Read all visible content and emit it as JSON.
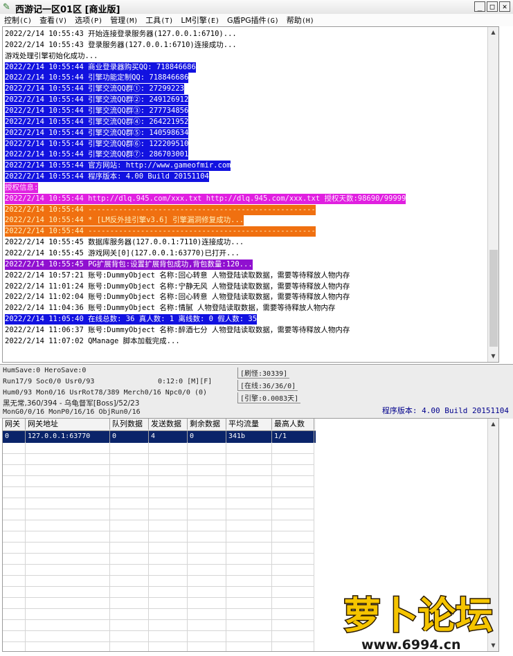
{
  "window": {
    "title": "西游记一区01区 [商业版]",
    "buttons": [
      "_",
      "□",
      "✕"
    ]
  },
  "menu": [
    {
      "label": "控制",
      "acc": "(C)"
    },
    {
      "label": "查看",
      "acc": "(V)"
    },
    {
      "label": "选项",
      "acc": "(P)"
    },
    {
      "label": "管理",
      "acc": "(M)"
    },
    {
      "label": "工具",
      "acc": "(T)"
    },
    {
      "label": "LM引擎",
      "acc": "(E)"
    },
    {
      "label": "G盾PG插件",
      "acc": "(G)"
    },
    {
      "label": "帮助",
      "acc": "(H)"
    }
  ],
  "colors": {
    "blue": "#1212e0",
    "magenta": "#e020e0",
    "orange": "#f07010",
    "purple": "#9010d0",
    "selected_row": "#0a246a"
  },
  "log": [
    {
      "text": "2022/2/14 10:55:43 开始连接登录服务器(127.0.0.1:6710)...",
      "hl": ""
    },
    {
      "text": "2022/2/14 10:55:43 登录服务器(127.0.0.1:6710)连接成功...",
      "hl": ""
    },
    {
      "text": "游戏处理引擎初始化成功...",
      "hl": ""
    },
    {
      "text": "2022/2/14 10:55:44 商业登录器购买QQ: 718846686",
      "hl": "blue"
    },
    {
      "text": "2022/2/14 10:55:44 引擎功能定制QQ: 718846686",
      "hl": "blue"
    },
    {
      "text": "2022/2/14 10:55:44 引擎交流QQ群①: 27299223",
      "hl": "blue"
    },
    {
      "text": "2022/2/14 10:55:44 引擎交流QQ群②: 249126912",
      "hl": "blue"
    },
    {
      "text": "2022/2/14 10:55:44 引擎交流QQ群③: 277734856",
      "hl": "blue"
    },
    {
      "text": "2022/2/14 10:55:44 引擎交流QQ群④: 264221952",
      "hl": "blue"
    },
    {
      "text": "2022/2/14 10:55:44 引擎交流QQ群⑤: 140598634",
      "hl": "blue"
    },
    {
      "text": "2022/2/14 10:55:44 引擎交流QQ群⑥: 122209510",
      "hl": "blue"
    },
    {
      "text": "2022/2/14 10:55:44 引擎交流QQ群⑦: 286703001",
      "hl": "blue"
    },
    {
      "text": "2022/2/14 10:55:44 官方网站: http://www.gameofmir.com",
      "hl": "blue"
    },
    {
      "text": "2022/2/14 10:55:44 程序版本: 4.00 Build 20151104",
      "hl": "blue"
    },
    {
      "text": "授权信息:",
      "hl": "magenta"
    },
    {
      "text": "2022/2/14 10:55:44 http://dlq.945.com/xxx.txt http://dlq.945.com/xxx.txt 授权天数:98690/99999",
      "hl": "magenta"
    },
    {
      "text": "2022/2/14 10:55:44 ----------------------------------------------------",
      "hl": "orange"
    },
    {
      "text": "2022/2/14 10:55:44 * [LM反外挂引擎v3.6] 引擎漏洞修复成功...",
      "hl": "orange"
    },
    {
      "text": "2022/2/14 10:55:44 ----------------------------------------------------",
      "hl": "orange"
    },
    {
      "text": "2022/2/14 10:55:45 数据库服务器(127.0.0.1:7110)连接成功...",
      "hl": ""
    },
    {
      "text": "2022/2/14 10:55:45 游戏网关[0](127.0.0.1:63770)已打开...",
      "hl": ""
    },
    {
      "text": "2022/2/14 10:55:45 PG扩展背包:设置扩展背包成功,背包数量:120...",
      "hl": "purple"
    },
    {
      "text": "2022/2/14 10:57:21 账号:DummyObject 名称:回心转意 人物登陆读取数据，需要等待释放人物内存",
      "hl": ""
    },
    {
      "text": "2022/2/14 11:01:24 账号:DummyObject 名称:宁静无风 人物登陆读取数据，需要等待释放人物内存",
      "hl": ""
    },
    {
      "text": "2022/2/14 11:02:04 账号:DummyObject 名称:回心转意 人物登陆读取数据，需要等待释放人物内存",
      "hl": ""
    },
    {
      "text": "2022/2/14 11:04:36 账号:DummyObject 名称:情腻 人物登陆读取数据，需要等待释放人物内存",
      "hl": ""
    },
    {
      "text": "2022/2/14 11:05:40 在线总数: 36 真人数: 1 离线数: 0 假人数: 35",
      "hl": "blue"
    },
    {
      "text": "2022/2/14 11:06:37 账号:DummyObject 名称:醉酒七分 人物登陆读取数据，需要等待释放人物内存",
      "hl": ""
    },
    {
      "text": "2022/2/14 11:07:02 QManage 脚本加载完成...",
      "hl": ""
    }
  ],
  "status": {
    "line1": "HumSave:0 HeroSave:0",
    "line2": "Run17/9 Soc0/0 Usr0/93",
    "timer": "0:12:0 [M][F]",
    "line3": "Hum0/93 Mon0/16 UsrRot78/389 Merch0/16 Npc0/0 (0)",
    "line4": "黑无常,360/394 - 乌龟督军[Boss]/52/23",
    "line5": "MonG0/0/16 MonP0/16/16 ObjRun0/16",
    "refresh": "[刷怪:30339]",
    "online": "[在线:36/36/0]",
    "engine": "[引擎:0.0083天]",
    "version": "程序版本: 4.00 Build 20151104"
  },
  "grid": {
    "headers": [
      "网关",
      "网关地址",
      "队列数据",
      "发送数据",
      "剩余数据",
      "平均流量",
      "最高人数"
    ],
    "rows": [
      [
        "0",
        "127.0.0.1:63770",
        "0",
        "4",
        "0",
        "341b",
        "1/1"
      ]
    ]
  },
  "watermark": {
    "text": "萝卜论坛",
    "url": "www.6994.cn"
  }
}
